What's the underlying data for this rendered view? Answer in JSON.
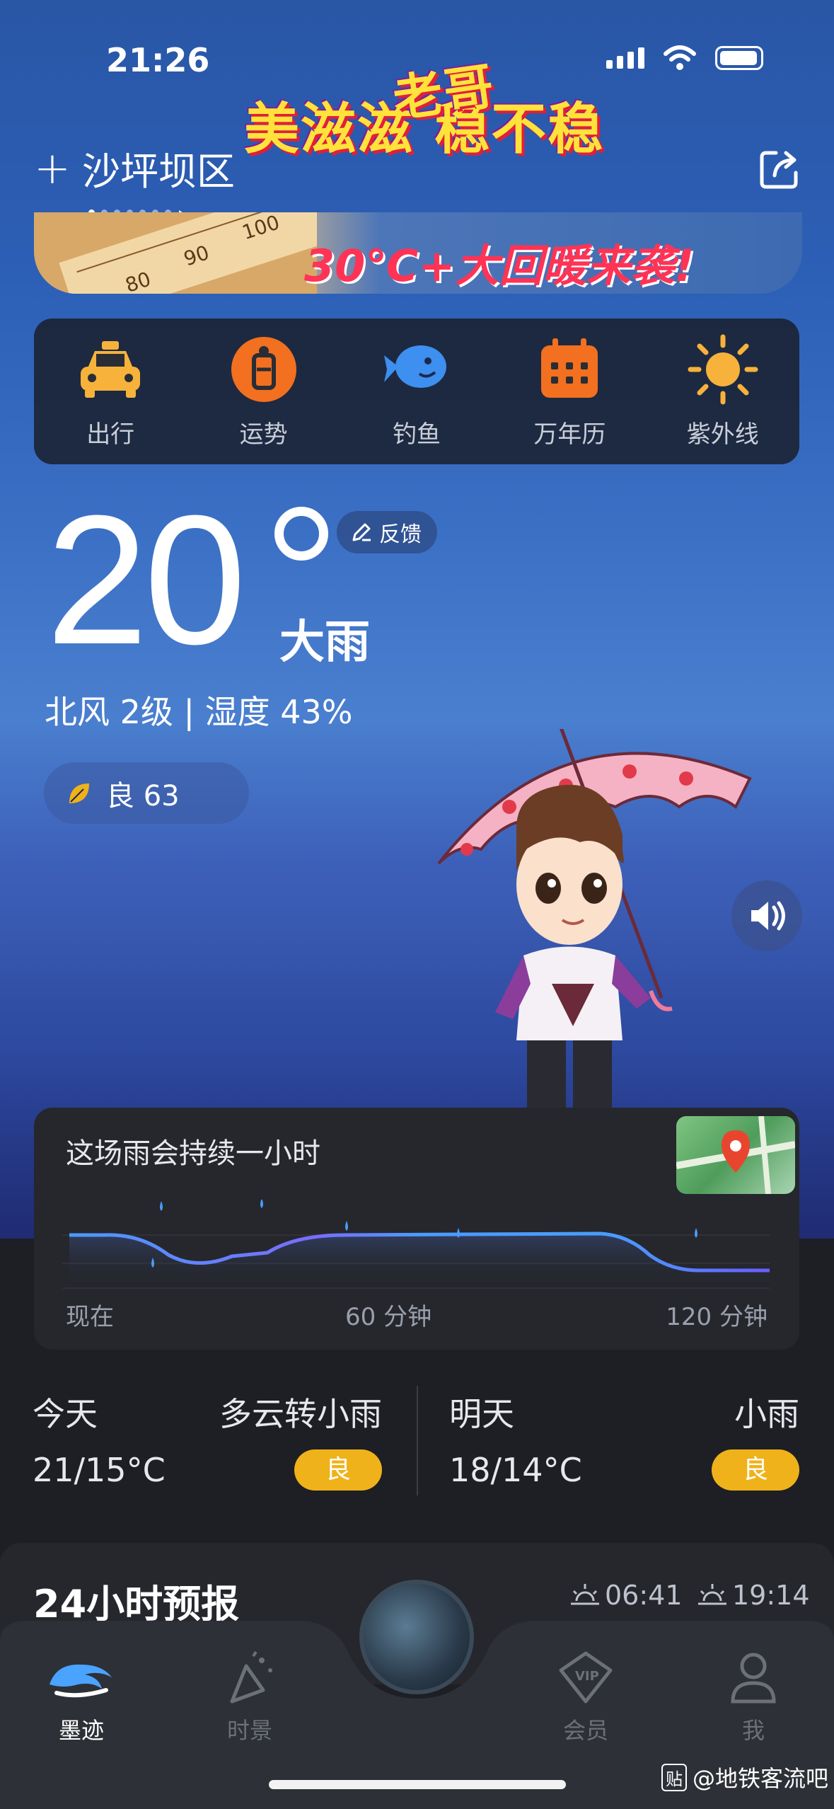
{
  "status_bar": {
    "time": "21:26"
  },
  "header": {
    "location": "沙坪坝区",
    "plus": "+",
    "page_dots": 8,
    "active_dot": 0
  },
  "banner": {
    "title_top": "老哥",
    "title": "美滋滋 稳不稳",
    "subtitle": "30℃+大回暖来袭!",
    "thermometer_marks": [
      "100",
      "90",
      "80"
    ]
  },
  "quick_actions": [
    {
      "label": "出行",
      "icon": "taxi-icon"
    },
    {
      "label": "运势",
      "icon": "fortune-icon"
    },
    {
      "label": "钓鱼",
      "icon": "fish-icon"
    },
    {
      "label": "万年历",
      "icon": "calendar-icon"
    },
    {
      "label": "紫外线",
      "icon": "sun-icon"
    }
  ],
  "current": {
    "temperature": "20",
    "feedback": "反馈",
    "condition": "大雨",
    "wind_humidity": "北风 2级 | 湿度 43%",
    "aqi": "良 63"
  },
  "rain_card": {
    "title": "这场雨会持续一小时",
    "axis": [
      "现在",
      "60 分钟",
      "120 分钟"
    ]
  },
  "forecast": {
    "today": {
      "day": "今天",
      "condition": "多云转小雨",
      "range": "21/15°C",
      "aqi": "良"
    },
    "tomorrow": {
      "day": "明天",
      "condition": "小雨",
      "range": "18/14°C",
      "aqi": "良"
    }
  },
  "hourly": {
    "title": "24小时预报",
    "sunrise": "06:41",
    "sunset": "19:14"
  },
  "tabbar": [
    {
      "label": "墨迹",
      "active": true
    },
    {
      "label": "时景",
      "active": false
    },
    {
      "label": "会员",
      "active": false
    },
    {
      "label": "我",
      "active": false
    }
  ],
  "watermark": {
    "badge": "贴",
    "text": "@地铁客流吧"
  },
  "colors": {
    "accent_yellow": "#f0b21a",
    "line_blue": "#4a9cff",
    "line_purple": "#6b5cff"
  }
}
